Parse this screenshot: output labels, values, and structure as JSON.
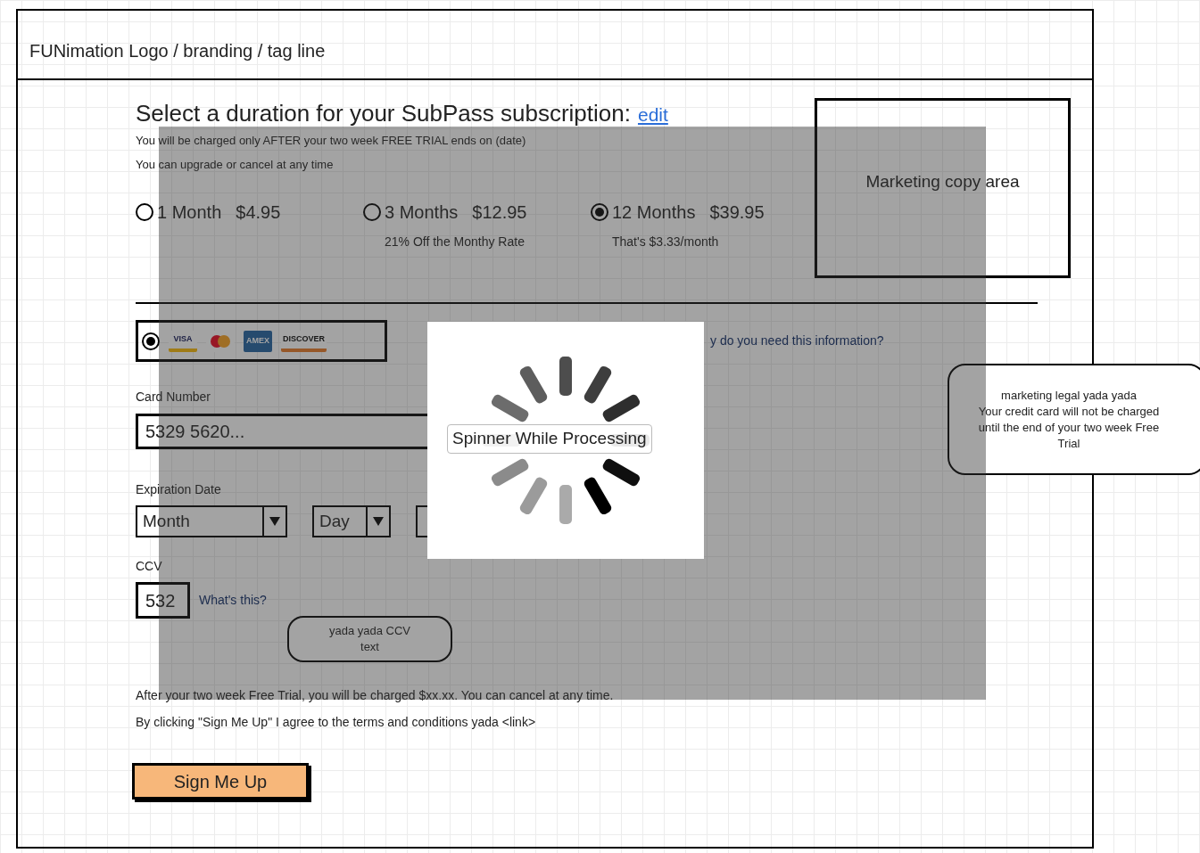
{
  "header": {
    "title": "FUNimation Logo / branding / tag line"
  },
  "heading": {
    "text": "Select a duration for your SubPass subscription:",
    "link": "edit"
  },
  "notes": [
    "You will be charged only AFTER your two week FREE TRIAL ends on (date)",
    "You can upgrade or cancel at any time"
  ],
  "plans": [
    {
      "label": "1 Month",
      "price": "$4.95",
      "selected": false
    },
    {
      "label": "3 Months",
      "price": "$12.95",
      "note": "21% Off the Monthy Rate",
      "selected": false
    },
    {
      "label": "12 Months",
      "price": "$39.95",
      "note": "That's $3.33/month",
      "selected": true
    }
  ],
  "marketing_box": {
    "text": "Marketing copy area"
  },
  "payment": {
    "selected": true,
    "cards": [
      {
        "kind": "visa",
        "label": "VISA"
      },
      {
        "kind": "mastercard"
      },
      {
        "kind": "amex",
        "label": "AMEX"
      },
      {
        "kind": "discover",
        "label": "DISCOVER"
      }
    ],
    "info_link": "y do you need this information?"
  },
  "card_number": {
    "label": "Card Number",
    "value": "5329 5620..."
  },
  "expiration": {
    "label": "Expiration Date",
    "selects": [
      {
        "value": "Month"
      },
      {
        "value": "Day"
      }
    ]
  },
  "ccv": {
    "label": "CCV",
    "value": "532",
    "link": "What's this?",
    "bubble": "yada yada CCV text"
  },
  "legal_bubble": {
    "lines": [
      "marketing legal yada yada",
      "Your credit card will not be charged until the end of your two week Free Trial"
    ]
  },
  "footer_notes": [
    "After your two week Free Trial, you will be charged $xx.xx. You can cancel at any time.",
    "By clicking \"Sign Me Up\" I agree to the terms and conditions yada <link>"
  ],
  "submit": {
    "label": "Sign Me Up"
  },
  "overlay": {
    "spinner_label": "Spinner While Processing"
  }
}
